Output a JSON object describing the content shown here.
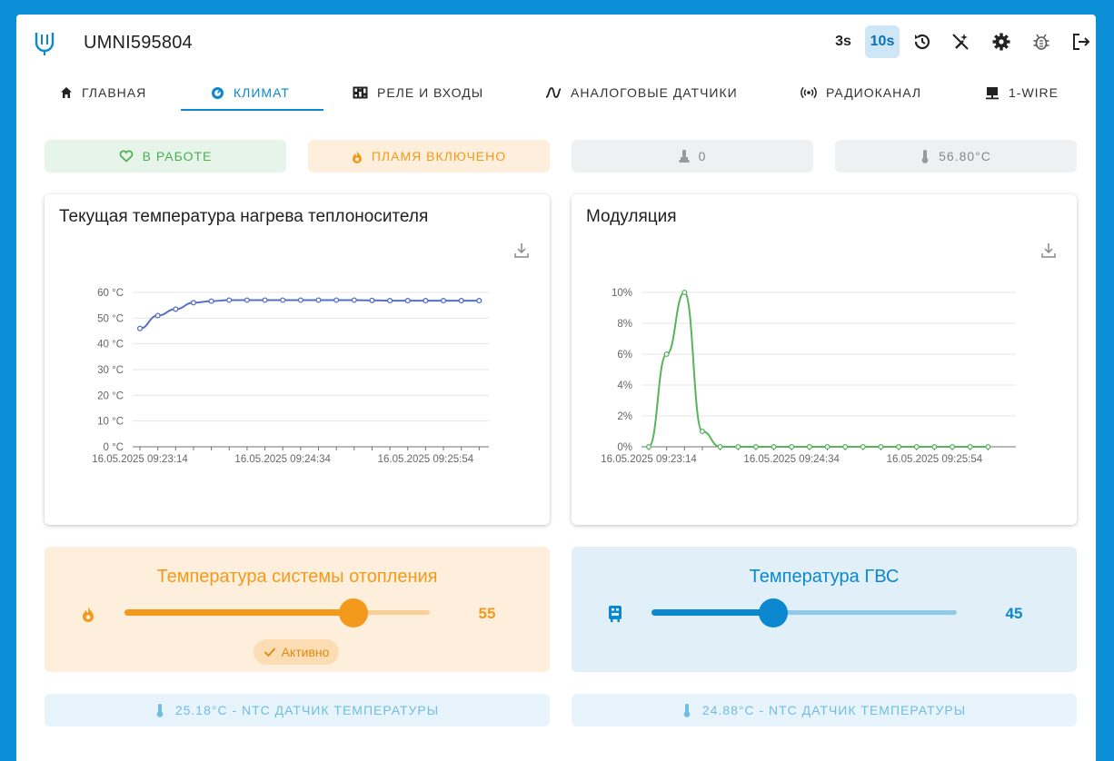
{
  "header": {
    "device_name": "UMNI595804",
    "interval_3s": "3s",
    "interval_10s": "10s"
  },
  "tabs": [
    {
      "label": "ГЛАВНАЯ",
      "icon": "home-icon"
    },
    {
      "label": "КЛИМАТ",
      "icon": "thermostat-icon"
    },
    {
      "label": "РЕЛЕ И ВХОДЫ",
      "icon": "relay-icon"
    },
    {
      "label": "АНАЛОГОВЫЕ ДАТЧИКИ",
      "icon": "wave-icon"
    },
    {
      "label": "РАДИОКАНАЛ",
      "icon": "radio-icon"
    },
    {
      "label": "1-WIRE",
      "icon": "wire-icon"
    }
  ],
  "status": {
    "working": "В РАБОТЕ",
    "flame": "ПЛАМЯ ВКЛЮЧЕНО",
    "pressure": "0",
    "temperature": "56.80°C"
  },
  "colors": {
    "accent": "#0b88cf",
    "orange": "#f39a1c",
    "green": "#4caf50",
    "chart_blue": "#5470c6",
    "chart_green": "#59b35b"
  },
  "chart_data": [
    {
      "type": "line",
      "title": "Текущая температура нагрева теплоносителя",
      "x": [
        "16.05.2025 09:23:14",
        "",
        "",
        "",
        "",
        "",
        "",
        "",
        "16.05.2025 09:24:34",
        "",
        "",
        "",
        "",
        "",
        "",
        "",
        "16.05.2025 09:25:54",
        "",
        "",
        ""
      ],
      "tick_labels_x": [
        "16.05.2025 09:23:14",
        "16.05.2025 09:24:34",
        "16.05.2025 09:25:54"
      ],
      "series": [
        {
          "values": [
            46,
            51,
            53.5,
            56,
            56.6,
            57,
            57,
            57,
            57,
            57,
            57,
            57,
            57,
            56.9,
            56.8,
            56.8,
            56.8,
            56.8,
            56.8,
            56.8
          ]
        }
      ],
      "y_ticks": [
        "0 °C",
        "10 °C",
        "20 °C",
        "30 °C",
        "40 °C",
        "50 °C",
        "60 °C"
      ],
      "ylim": [
        0,
        60
      ],
      "grid": true,
      "color": "#5470c6"
    },
    {
      "type": "line",
      "title": "Модуляция",
      "x": [
        "16.05.2025 09:23:14",
        "",
        "",
        "",
        "",
        "",
        "",
        "",
        "16.05.2025 09:24:34",
        "",
        "",
        "",
        "",
        "",
        "",
        "",
        "16.05.2025 09:25:54",
        "",
        "",
        ""
      ],
      "tick_labels_x": [
        "16.05.2025 09:23:14",
        "16.05.2025 09:24:34",
        "16.05.2025 09:25:54"
      ],
      "series": [
        {
          "values": [
            0,
            6,
            10,
            1,
            0,
            0,
            0,
            0,
            0,
            0,
            0,
            0,
            0,
            0,
            0,
            0,
            0,
            0,
            0,
            0
          ]
        }
      ],
      "y_ticks": [
        "0%",
        "2%",
        "4%",
        "6%",
        "8%",
        "10%"
      ],
      "ylim": [
        0,
        10
      ],
      "grid": true,
      "color": "#59b35b"
    }
  ],
  "heating": {
    "title": "Температура системы отопления",
    "value": "55",
    "level": 0.75,
    "status": "Активно"
  },
  "dhw": {
    "title": "Температура ГВС",
    "value": "45",
    "level": 0.4
  },
  "sensors": {
    "left": "25.18°C - NTC ДАТЧИК ТЕМПЕРАТУРЫ",
    "right": "24.88°C - NTC ДАТЧИК ТЕМПЕРАТУРЫ"
  }
}
